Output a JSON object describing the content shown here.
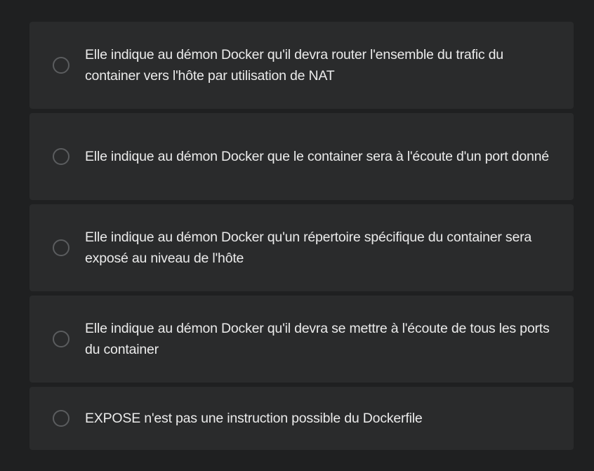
{
  "options": [
    {
      "label": "Elle indique au démon Docker qu'il devra router l'ensemble du trafic du container vers l'hôte par utilisation de NAT",
      "selected": false
    },
    {
      "label": "Elle indique au démon Docker que le container sera à l'écoute d'un port donné",
      "selected": false
    },
    {
      "label": "Elle indique au démon Docker qu'un répertoire spécifique du container sera exposé au niveau de l'hôte",
      "selected": false
    },
    {
      "label": "Elle indique au démon Docker qu'il devra se mettre à l'écoute de tous les ports du container",
      "selected": false
    },
    {
      "label": "EXPOSE n'est pas une instruction possible du Dockerfile",
      "selected": false
    }
  ],
  "colors": {
    "background": "#1f2021",
    "card": "#2a2b2c",
    "text": "#ebebeb",
    "radio_border": "#5b5d5f"
  }
}
